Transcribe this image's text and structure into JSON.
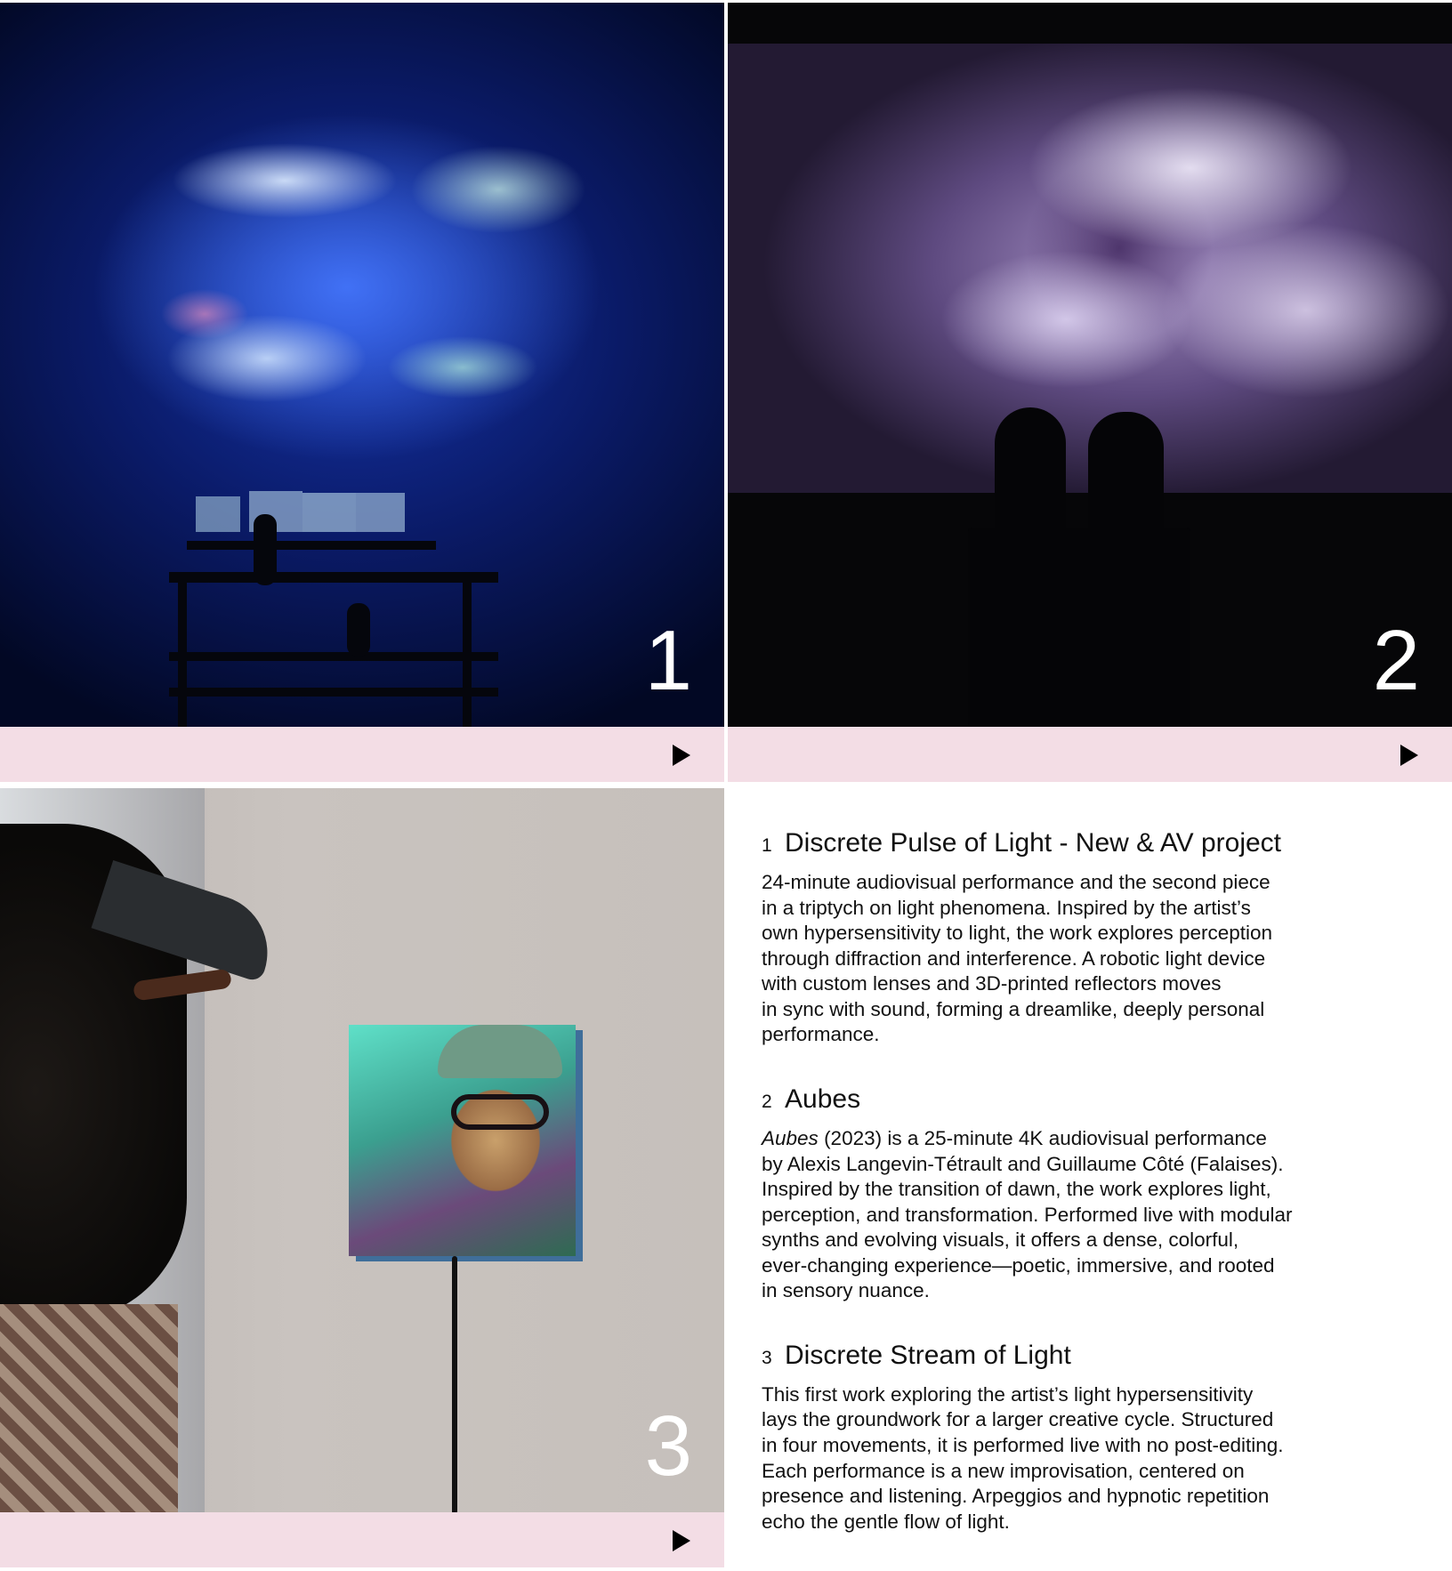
{
  "tiles": [
    {
      "number": "1",
      "play_icon": "play-icon"
    },
    {
      "number": "2",
      "play_icon": "play-icon"
    },
    {
      "number": "3",
      "play_icon": "play-icon"
    }
  ],
  "entries": [
    {
      "number": "1",
      "title": "Discrete Pulse of Light - New & AV project",
      "body": "24-minute audiovisual performance and the second piece\nin a triptych on light phenomena. Inspired by the artist’s\nown hypersensitivity to light, the work explores perception\nthrough diffraction and interference. A robotic light device\nwith custom lenses and 3D-printed reflectors moves\nin sync with sound, forming a dreamlike, deeply personal\nperformance."
    },
    {
      "number": "2",
      "title": "Aubes",
      "body_italic": "Aubes",
      "body": " (2023) is a 25-minute 4K audiovisual performance\nby Alexis Langevin-Tétrault and Guillaume Côté (Falaises).\nInspired by the transition of dawn, the work explores light,\nperception, and transformation. Performed live with modular\nsynths and evolving visuals, it offers a dense, colorful,\never-changing experience—poetic, immersive, and rooted\nin sensory nuance."
    },
    {
      "number": "3",
      "title": "Discrete Stream of Light",
      "body": "This first work exploring the artist’s light hypersensitivity\nlays the groundwork for a larger creative cycle. Structured\nin four movements, it is performed live with no post-editing.\nEach performance is a new improvisation, centered on\npresence and listening. Arpeggios and hypnotic repetition\necho the gentle flow of light."
    }
  ],
  "colors": {
    "bar": "#f3dde5",
    "text": "#111111",
    "number_overlay": "#ffffff"
  }
}
